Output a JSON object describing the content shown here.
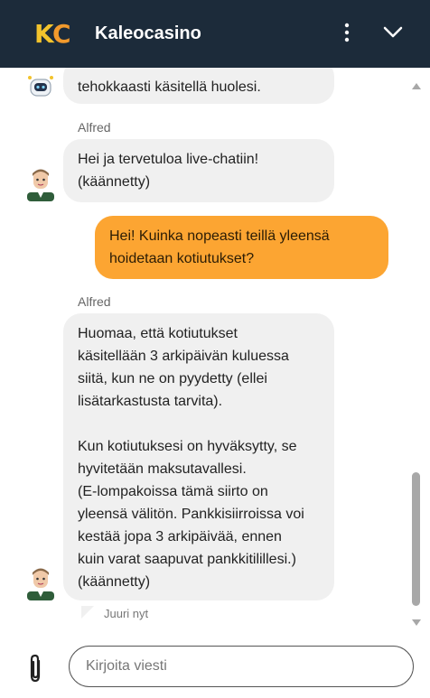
{
  "header": {
    "logo_text": "KC",
    "title": "Kaleocasino",
    "icons": {
      "menu": "more-vertical-icon",
      "collapse": "chevron-down-icon"
    }
  },
  "chat": {
    "messages": [
      {
        "from": "bot",
        "text": "tehokkaasti käsitellä huolesi."
      },
      {
        "from": "agent",
        "sender": "Alfred",
        "text": "Hei ja tervetuloa live-chatiin!\n(käännetty)"
      },
      {
        "from": "user",
        "text": "Hei! Kuinka nopeasti teillä yleensä\nhoidetaan kotiutukset?"
      },
      {
        "from": "agent",
        "sender": "Alfred",
        "text": "Huomaa, että kotiutukset\nkäsitellään 3 arkipäivän kuluessa\nsiitä, kun ne on pyydetty (ellei\nlisätarkastusta tarvita).\n\nKun kotiutuksesi on hyväksytty, se\nhyvitetään maksutavallesi.\n(E-lompakoissa tämä siirto on\nyleensä välitön. Pankkisiirroissa voi\nkestää jopa 3 arkipäivää, ennen\nkuin varat saapuvat pankkitilillesi.)\n(käännetty)"
      }
    ],
    "timestamp": "Juuri nyt"
  },
  "composer": {
    "placeholder": "Kirjoita viesti",
    "value": "",
    "attach_icon": "paperclip-icon"
  },
  "colors": {
    "header_bg": "#1c2b3a",
    "user_bubble": "#fca532",
    "agent_bubble": "#f0f0f0"
  }
}
